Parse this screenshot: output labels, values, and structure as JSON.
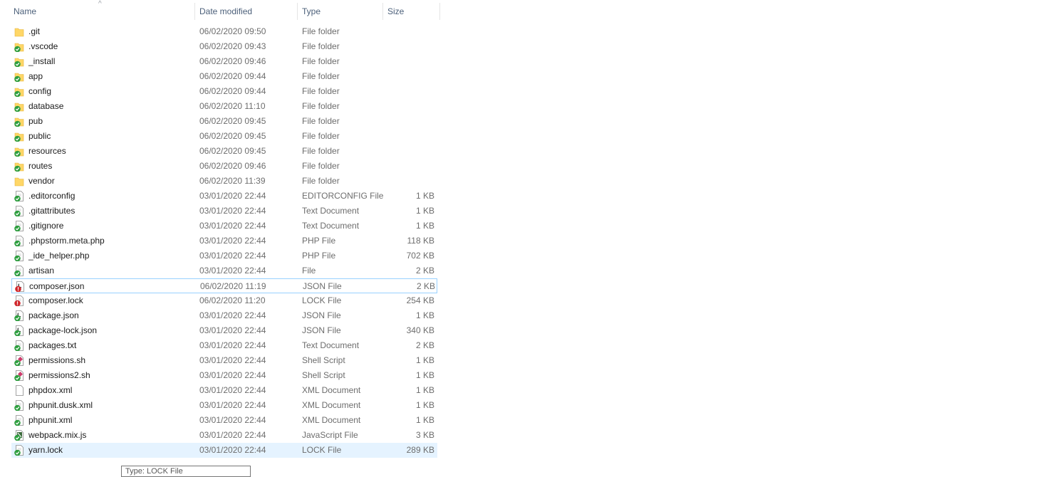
{
  "columns": {
    "name": "Name",
    "date": "Date modified",
    "type": "Type",
    "size": "Size"
  },
  "files": [
    {
      "name": ".git",
      "date": "06/02/2020 09:50",
      "type": "File folder",
      "size": "",
      "icon": "folder-icon"
    },
    {
      "name": ".vscode",
      "date": "06/02/2020 09:43",
      "type": "File folder",
      "size": "",
      "icon": "folder-synced-icon"
    },
    {
      "name": "_install",
      "date": "06/02/2020 09:46",
      "type": "File folder",
      "size": "",
      "icon": "folder-synced-icon"
    },
    {
      "name": "app",
      "date": "06/02/2020 09:44",
      "type": "File folder",
      "size": "",
      "icon": "folder-synced-icon"
    },
    {
      "name": "config",
      "date": "06/02/2020 09:44",
      "type": "File folder",
      "size": "",
      "icon": "folder-synced-icon"
    },
    {
      "name": "database",
      "date": "06/02/2020 11:10",
      "type": "File folder",
      "size": "",
      "icon": "folder-synced-icon"
    },
    {
      "name": "pub",
      "date": "06/02/2020 09:45",
      "type": "File folder",
      "size": "",
      "icon": "folder-synced-icon"
    },
    {
      "name": "public",
      "date": "06/02/2020 09:45",
      "type": "File folder",
      "size": "",
      "icon": "folder-synced-icon"
    },
    {
      "name": "resources",
      "date": "06/02/2020 09:45",
      "type": "File folder",
      "size": "",
      "icon": "folder-synced-icon"
    },
    {
      "name": "routes",
      "date": "06/02/2020 09:46",
      "type": "File folder",
      "size": "",
      "icon": "folder-synced-icon"
    },
    {
      "name": "vendor",
      "date": "06/02/2020 11:39",
      "type": "File folder",
      "size": "",
      "icon": "folder-icon"
    },
    {
      "name": ".editorconfig",
      "date": "03/01/2020 22:44",
      "type": "EDITORCONFIG File",
      "size": "1 KB",
      "icon": "file-synced-icon"
    },
    {
      "name": ".gitattributes",
      "date": "03/01/2020 22:44",
      "type": "Text Document",
      "size": "1 KB",
      "icon": "file-synced-icon"
    },
    {
      "name": ".gitignore",
      "date": "03/01/2020 22:44",
      "type": "Text Document",
      "size": "1 KB",
      "icon": "file-synced-icon"
    },
    {
      "name": ".phpstorm.meta.php",
      "date": "03/01/2020 22:44",
      "type": "PHP File",
      "size": "118 KB",
      "icon": "file-synced-icon"
    },
    {
      "name": "_ide_helper.php",
      "date": "03/01/2020 22:44",
      "type": "PHP File",
      "size": "702 KB",
      "icon": "file-synced-icon"
    },
    {
      "name": "artisan",
      "date": "03/01/2020 22:44",
      "type": "File",
      "size": "2 KB",
      "icon": "file-synced-icon"
    },
    {
      "name": "composer.json",
      "date": "06/02/2020 11:19",
      "type": "JSON File",
      "size": "2 KB",
      "icon": "json-modified-icon"
    },
    {
      "name": "composer.lock",
      "date": "06/02/2020 11:20",
      "type": "LOCK File",
      "size": "254 KB",
      "icon": "file-modified-icon"
    },
    {
      "name": "package.json",
      "date": "03/01/2020 22:44",
      "type": "JSON File",
      "size": "1 KB",
      "icon": "json-synced-icon"
    },
    {
      "name": "package-lock.json",
      "date": "03/01/2020 22:44",
      "type": "JSON File",
      "size": "340 KB",
      "icon": "json-synced-icon"
    },
    {
      "name": "packages.txt",
      "date": "03/01/2020 22:44",
      "type": "Text Document",
      "size": "2 KB",
      "icon": "file-synced-icon"
    },
    {
      "name": "permissions.sh",
      "date": "03/01/2020 22:44",
      "type": "Shell Script",
      "size": "1 KB",
      "icon": "script-synced-icon"
    },
    {
      "name": "permissions2.sh",
      "date": "03/01/2020 22:44",
      "type": "Shell Script",
      "size": "1 KB",
      "icon": "script-synced-icon"
    },
    {
      "name": "phpdox.xml",
      "date": "03/01/2020 22:44",
      "type": "XML Document",
      "size": "1 KB",
      "icon": "file-icon"
    },
    {
      "name": "phpunit.dusk.xml",
      "date": "03/01/2020 22:44",
      "type": "XML Document",
      "size": "1 KB",
      "icon": "file-synced-icon"
    },
    {
      "name": "phpunit.xml",
      "date": "03/01/2020 22:44",
      "type": "XML Document",
      "size": "1 KB",
      "icon": "file-synced-icon"
    },
    {
      "name": "webpack.mix.js",
      "date": "03/01/2020 22:44",
      "type": "JavaScript File",
      "size": "3 KB",
      "icon": "js-synced-icon"
    },
    {
      "name": "yarn.lock",
      "date": "03/01/2020 22:44",
      "type": "LOCK File",
      "size": "289 KB",
      "icon": "file-synced-icon"
    }
  ],
  "focused_index": 17,
  "selected_index": 28,
  "tooltip": "Type: LOCK File",
  "colors": {
    "selected_bg": "#e5f3ff",
    "focus_border": "#99d1ff",
    "synced": "#2e9e3f",
    "modified": "#d0262b",
    "folder": "#ffd767"
  }
}
